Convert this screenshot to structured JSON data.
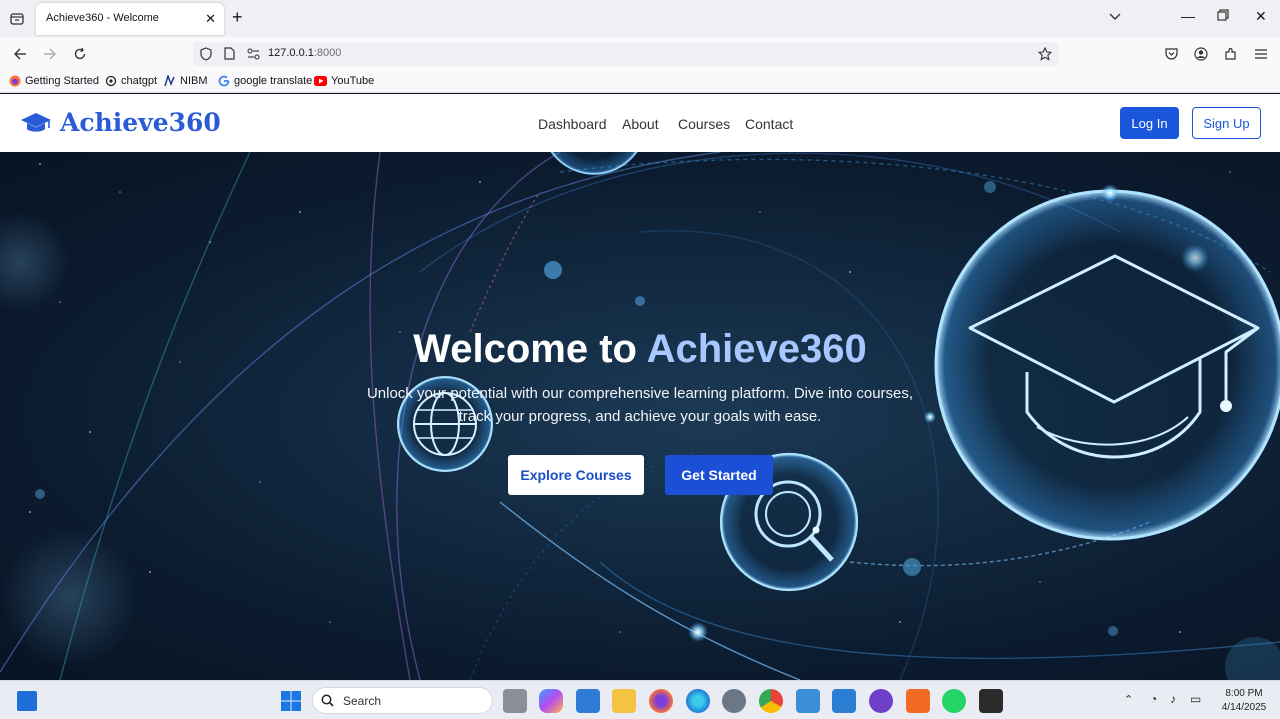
{
  "browser": {
    "tab_title": "Achieve360 - Welcome",
    "url_host": "127.0.0.1",
    "url_port": ":8000",
    "bookmarks": [
      {
        "label": "Getting Started",
        "icon": "firefox-icon"
      },
      {
        "label": "chatgpt",
        "icon": "chatgpt-icon"
      },
      {
        "label": "NIBM",
        "icon": "nibm-icon"
      },
      {
        "label": "google translate",
        "icon": "google-icon"
      },
      {
        "label": "YouTube",
        "icon": "youtube-icon"
      }
    ]
  },
  "site": {
    "logo_text": "Achieve360",
    "nav": [
      "Dashboard",
      "About",
      "Courses",
      "Contact"
    ],
    "login_label": "Log In",
    "signup_label": "Sign Up",
    "brand_color": "#1a56db"
  },
  "hero": {
    "title_prefix": "Welcome to ",
    "title_accent": "Achieve360",
    "subtitle": "Unlock your potential with our comprehensive learning platform. Dive into courses, track your progress, and achieve your goals with ease.",
    "explore_label": "Explore Courses",
    "started_label": "Get Started"
  },
  "taskbar": {
    "search_placeholder": "Search",
    "time": "8:00 PM",
    "date": "4/14/2025"
  }
}
